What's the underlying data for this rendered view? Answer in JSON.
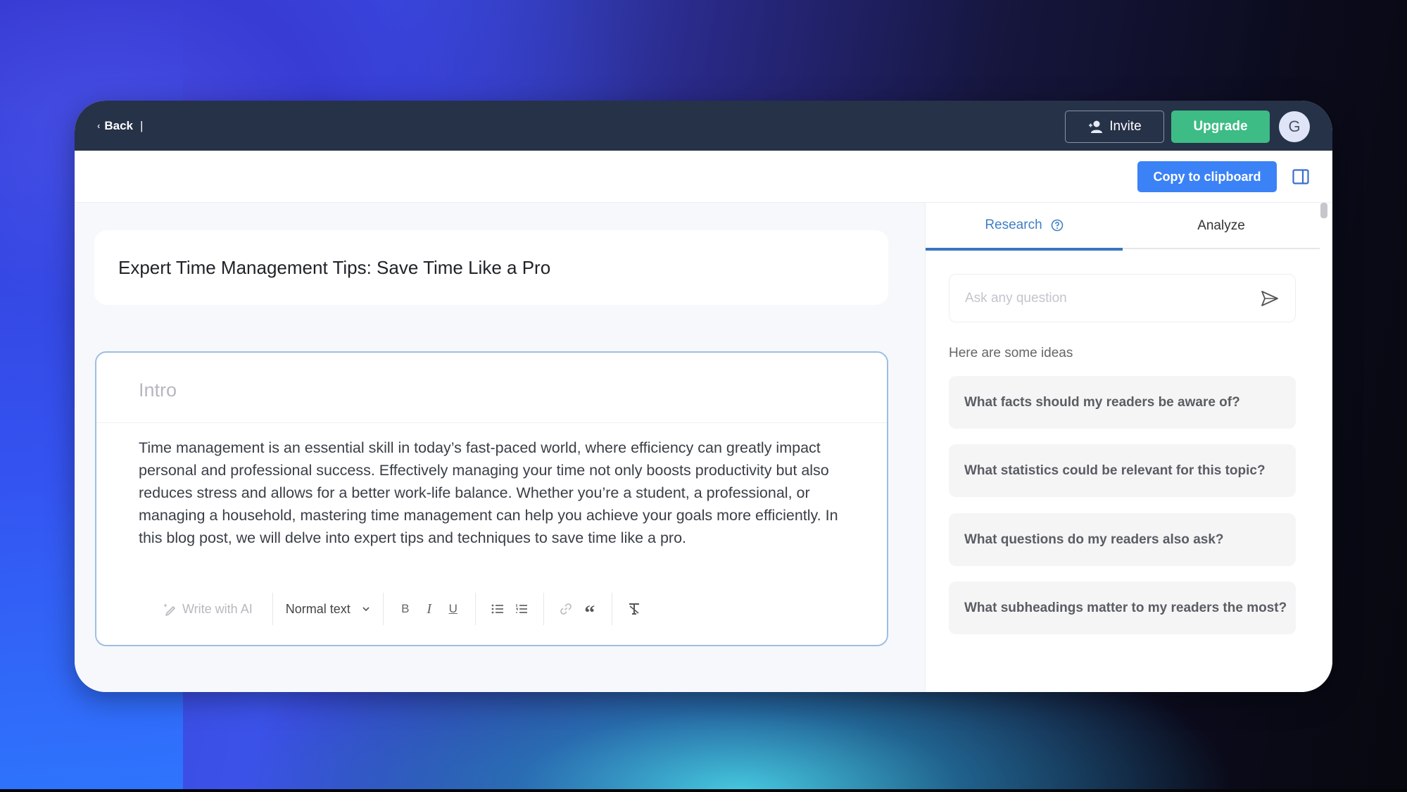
{
  "topbar": {
    "back_label": "Back",
    "separator": "|",
    "invite_label": "Invite",
    "upgrade_label": "Upgrade",
    "avatar_initial": "G"
  },
  "subbar": {
    "copy_label": "Copy to clipboard"
  },
  "editor": {
    "title": "Expert Time Management Tips: Save Time Like a Pro",
    "section": {
      "heading_placeholder": "Intro",
      "body": "Time management is an essential skill in today’s fast-paced world, where efficiency can greatly impact personal and professional success. Effectively managing your time not only boosts productivity but also reduces stress and allows for a better work-life balance. Whether you’re a student, a professional, or managing a household, mastering time management can help you achieve your goals more efficiently. In this blog post, we will delve into expert tips and techniques to save time like a pro."
    },
    "toolbar": {
      "write_ai_label": "Write with AI",
      "format_selected": "Normal text",
      "icons": [
        "sparkle-pen-icon",
        "chevron-down-icon",
        "bold-icon",
        "italic-icon",
        "underline-icon",
        "bullet-list-icon",
        "numbered-list-icon",
        "link-icon",
        "quote-icon",
        "clear-format-icon"
      ]
    }
  },
  "sidepanel": {
    "tabs": [
      {
        "label": "Research",
        "active": true
      },
      {
        "label": "Analyze",
        "active": false
      }
    ],
    "ask_placeholder": "Ask any question",
    "ask_value": "",
    "ideas_label": "Here are some ideas",
    "ideas": [
      "What facts should my readers be aware of?",
      "What statistics could be relevant for this topic?",
      "What questions do my readers also ask?",
      "What subheadings matter to my readers the most?"
    ]
  },
  "colors": {
    "topbar": "#263248",
    "upgrade": "#3dbc85",
    "primary": "#3b82f6",
    "active_tab": "#3a74c0",
    "section_border": "#9dbfe2"
  }
}
